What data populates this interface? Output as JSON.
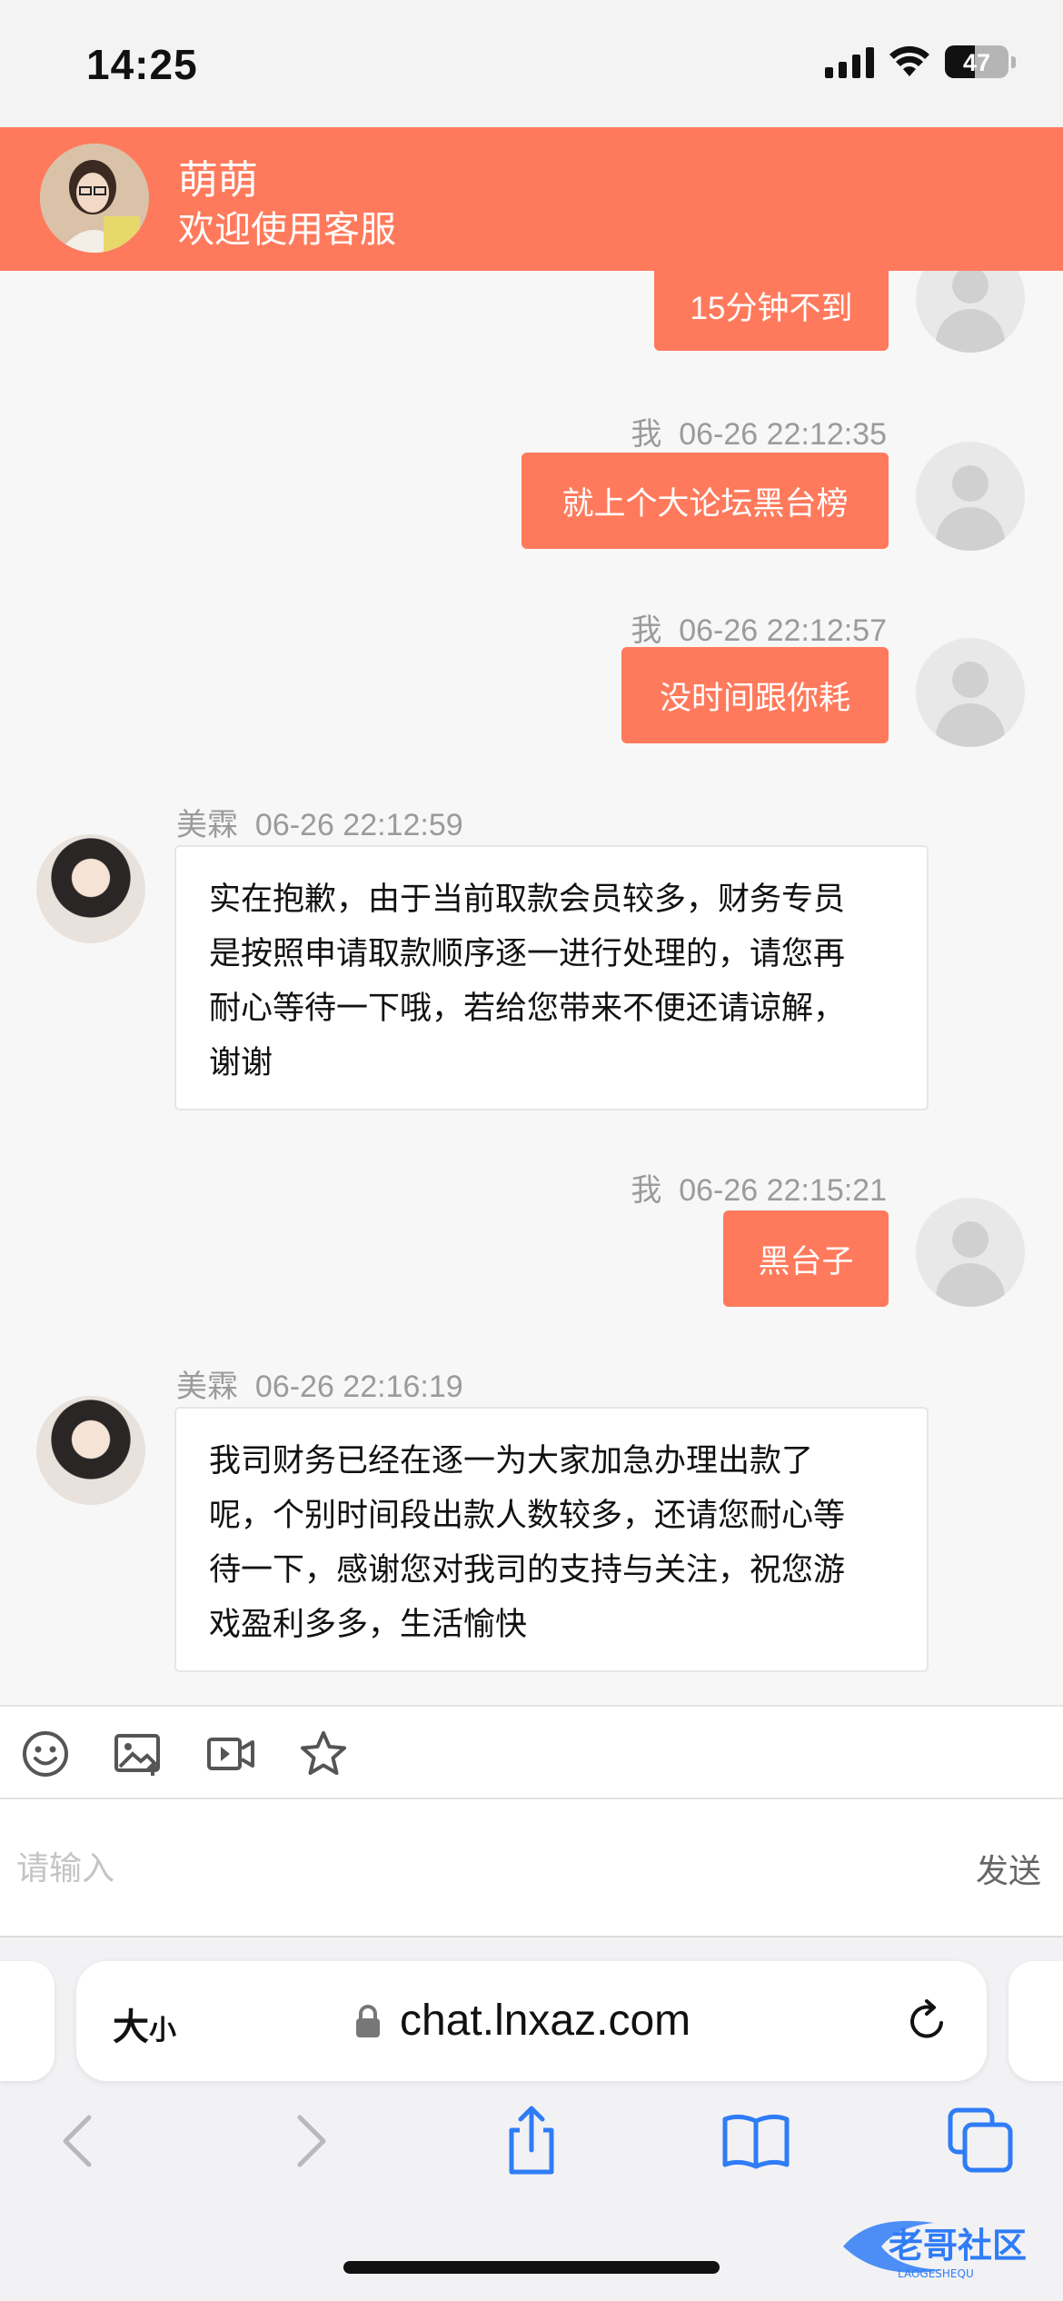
{
  "status_bar": {
    "time": "14:25",
    "battery": "47",
    "battery_level": 0.47
  },
  "header": {
    "agent_name": "萌萌",
    "subtitle": "欢迎使用客服"
  },
  "messages": [
    {
      "side": "out",
      "text": "15分钟不到"
    },
    {
      "side": "out",
      "sender": "我",
      "time": "06-26 22:12:35",
      "text": "就上个大论坛黑台榜"
    },
    {
      "side": "out",
      "sender": "我",
      "time": "06-26 22:12:57",
      "text": "没时间跟你耗"
    },
    {
      "side": "in",
      "sender": "美霖",
      "time": "06-26 22:12:59",
      "lines": [
        "实在抱歉，由于当前取款会员较多，财务专员",
        "是按照申请取款顺序逐一进行处理的，请您再",
        "耐心等待一下哦，若给您带来不便还请谅解，",
        "谢谢"
      ]
    },
    {
      "side": "out",
      "sender": "我",
      "time": "06-26 22:15:21",
      "text": "黑台子"
    },
    {
      "side": "in",
      "sender": "美霖",
      "time": "06-26 22:16:19",
      "lines": [
        "我司财务已经在逐一为大家加急办理出款了",
        "呢，个别时间段出款人数较多，还请您耐心等",
        "待一下，感谢您对我司的支持与关注，祝您游",
        "戏盈利多多，生活愉快"
      ]
    }
  ],
  "toolbar": {
    "icons": [
      "emoji-icon",
      "image-icon",
      "video-icon",
      "star-icon"
    ]
  },
  "input": {
    "placeholder": "请输入",
    "send_label": "发送"
  },
  "browser": {
    "text_size_big": "大",
    "text_size_small": "小",
    "url": "chat.lnxaz.com"
  },
  "watermark": {
    "text": "老哥社区",
    "sub": "LAOGESHEQU"
  },
  "colors": {
    "accent": "#ff7a5c",
    "background": "#f7f7f7",
    "ios_blue": "#2f7cf6"
  }
}
